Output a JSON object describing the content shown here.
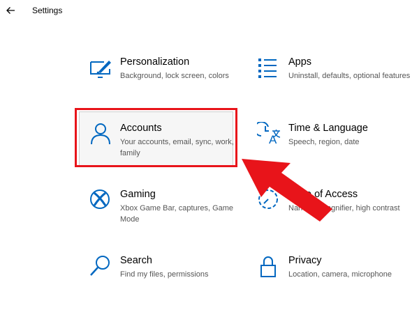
{
  "window": {
    "title": "Settings"
  },
  "tiles": [
    {
      "title": "Personalization",
      "desc": "Background, lock screen, colors",
      "icon": "personalization-icon"
    },
    {
      "title": "Apps",
      "desc": "Uninstall, defaults, optional features",
      "icon": "apps-icon"
    },
    {
      "title": "Accounts",
      "desc": "Your accounts, email, sync, work, family",
      "icon": "accounts-icon"
    },
    {
      "title": "Time & Language",
      "desc": "Speech, region, date",
      "icon": "time-language-icon"
    },
    {
      "title": "Gaming",
      "desc": "Xbox Game Bar, captures, Game Mode",
      "icon": "xbox-icon"
    },
    {
      "title": "Ease of Access",
      "desc": "Narrator, magnifier, high contrast",
      "icon": "ease-of-access-icon"
    },
    {
      "title": "Search",
      "desc": "Find my files, permissions",
      "icon": "search-icon"
    },
    {
      "title": "Privacy",
      "desc": "Location, camera, microphone",
      "icon": "lock-icon"
    }
  ],
  "colors": {
    "accent": "#0067c0",
    "annotation": "#e8141a"
  }
}
